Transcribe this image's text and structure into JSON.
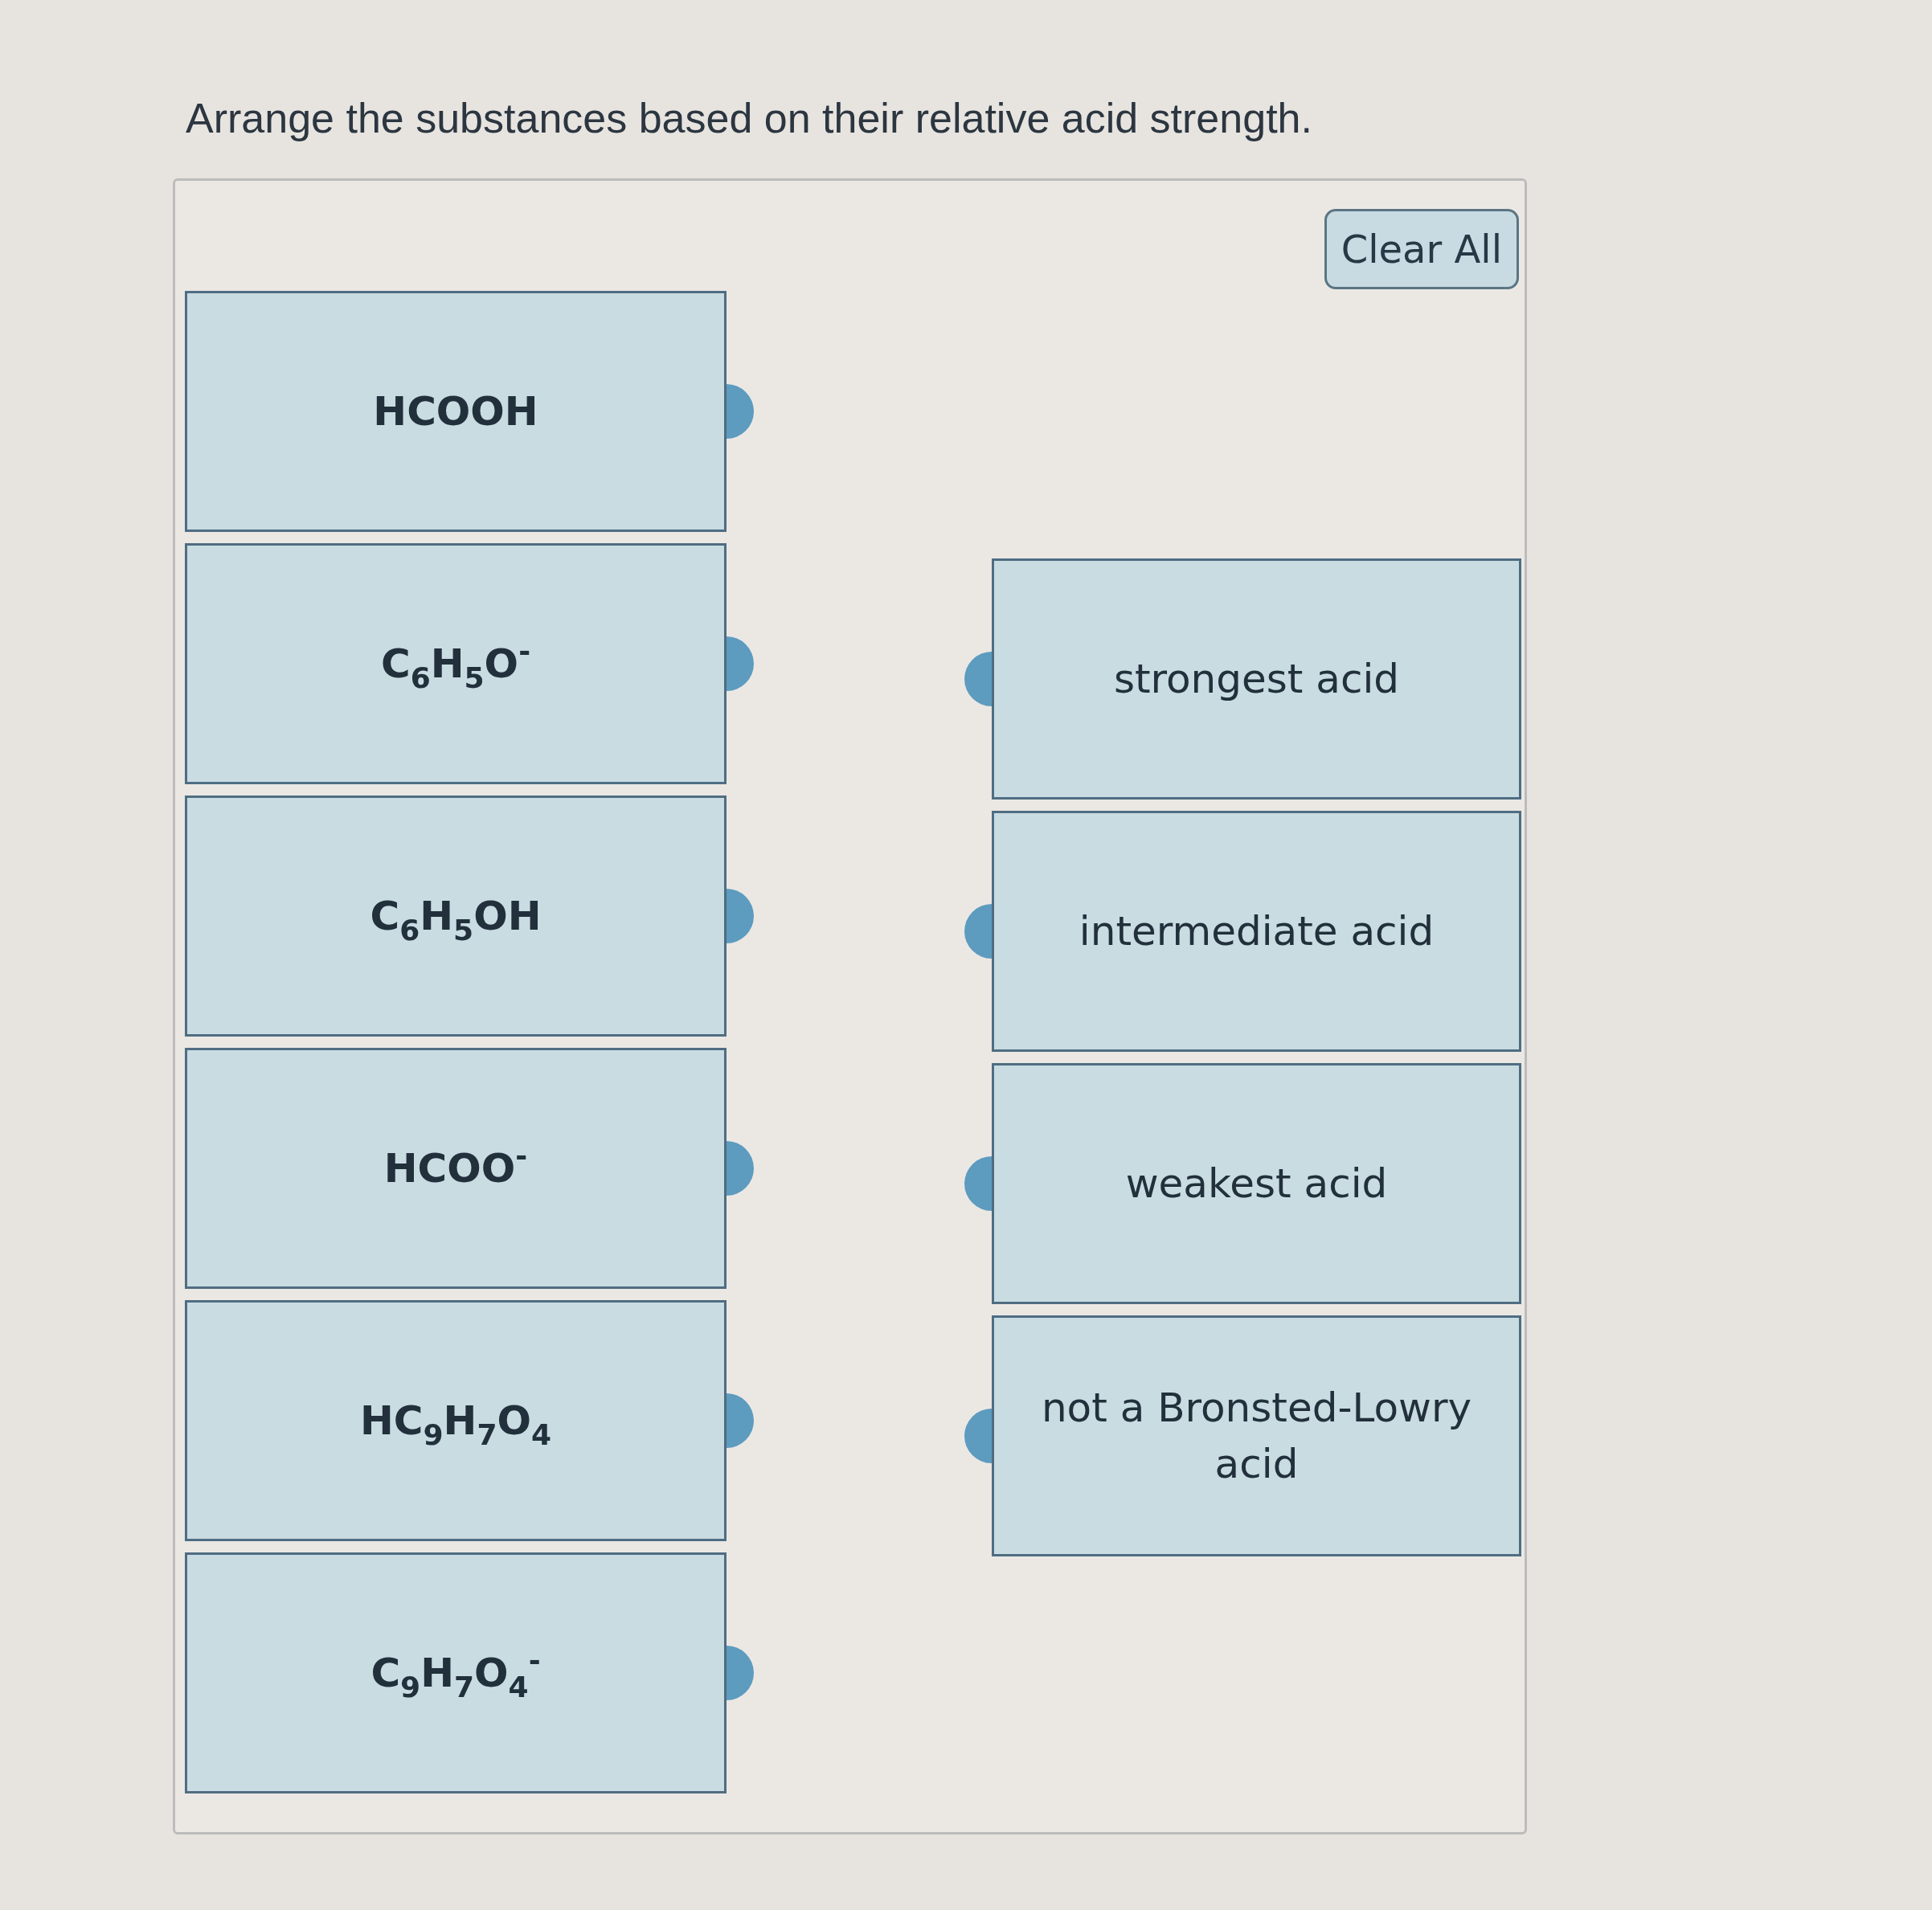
{
  "prompt": "Arrange the substances based on their relative acid strength.",
  "clear_button": "Clear All",
  "substances": [
    "HCOOH",
    "C$_{6}$H$_{5}$O$^{-}$",
    "C$_{6}$H$_{5}$OH",
    "HCOO$^{-}$",
    "HC$_{9}$H$_{7}$O$_{4}$",
    "C$_{9}$H$_{7}$O$_{4}$$^{-}$"
  ],
  "categories": [
    "strongest acid",
    "intermediate acid",
    "weakest acid",
    "not a Bronsted-Lowry acid"
  ]
}
